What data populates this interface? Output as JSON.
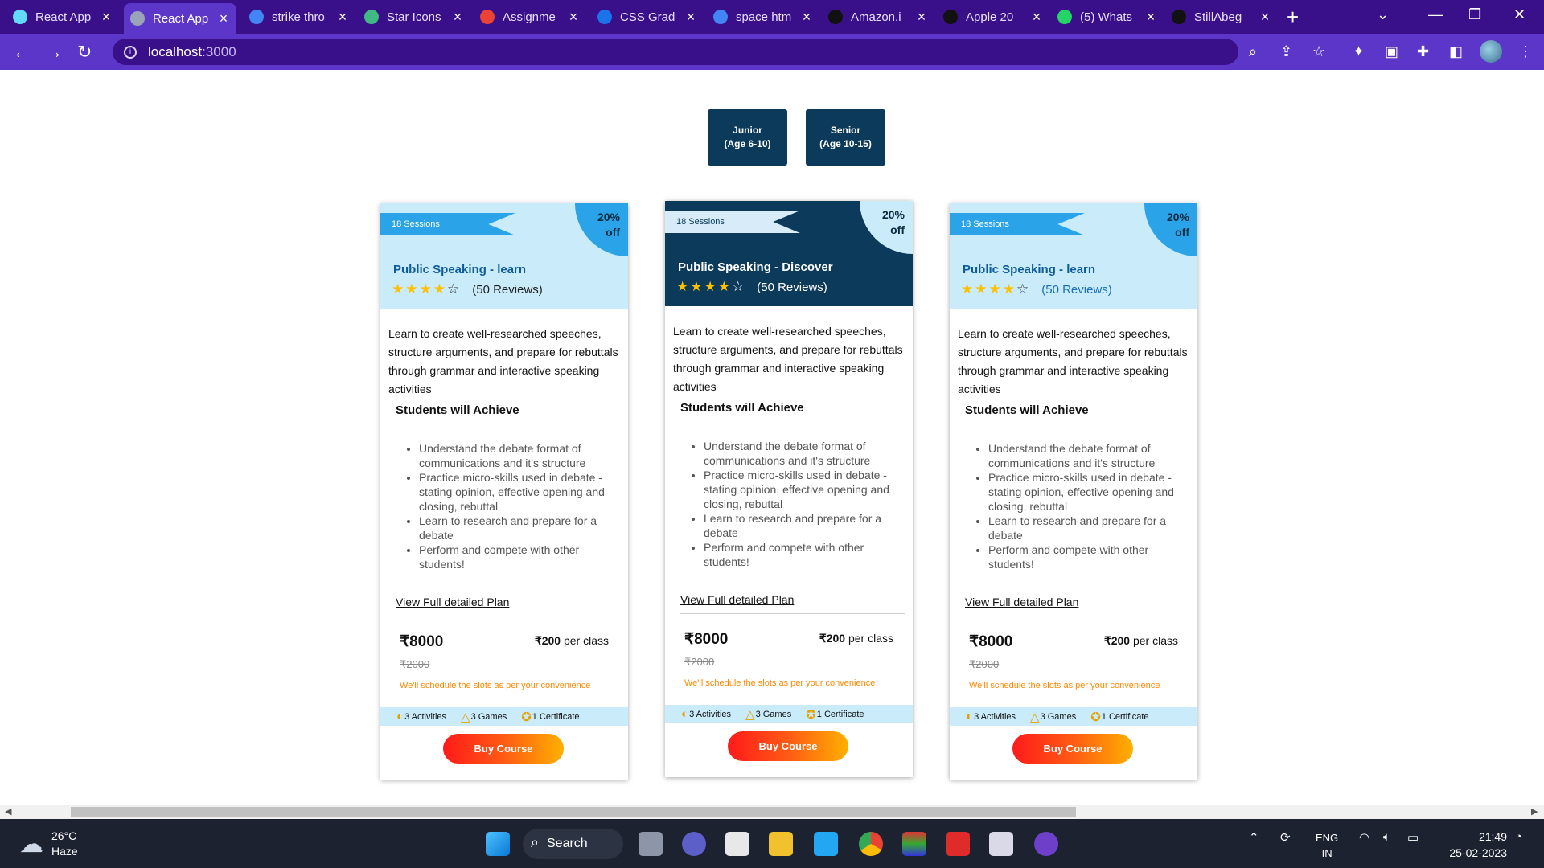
{
  "browser": {
    "tabs": [
      {
        "title": "React App",
        "favicon": "react-icon",
        "color": "#61dafb"
      },
      {
        "title": "React App",
        "favicon": "globe-icon",
        "color": "#9aa4b8"
      },
      {
        "title": "strike thro",
        "favicon": "google-icon",
        "color": "#4285f4"
      },
      {
        "title": "Star Icons",
        "favicon": "vue-icon",
        "color": "#42b883"
      },
      {
        "title": "Assignme",
        "favicon": "gmail-icon",
        "color": "#ea4335"
      },
      {
        "title": "CSS Grad",
        "favicon": "edge-icon",
        "color": "#1a73e8"
      },
      {
        "title": "space htm",
        "favicon": "google-icon",
        "color": "#4285f4"
      },
      {
        "title": "Amazon.i",
        "favicon": "amazon-icon",
        "color": "#111111"
      },
      {
        "title": "Apple 20",
        "favicon": "amazon-icon",
        "color": "#111111"
      },
      {
        "title": "(5) Whats",
        "favicon": "whatsapp-icon",
        "color": "#25d366"
      },
      {
        "title": "StillAbeg",
        "favicon": "github-icon",
        "color": "#111111"
      }
    ],
    "active_tab_index": 1,
    "url_host": "localhost",
    "url_port": ":3000"
  },
  "age_groups": [
    {
      "line1": "Junior",
      "line2": "(Age 6-10)"
    },
    {
      "line1": "Senior",
      "line2": "(Age 10-15)"
    }
  ],
  "cards": [
    {
      "sessions": "18 Sessions",
      "discount_pct": "20%",
      "discount_off": "off",
      "title": "Public Speaking - learn",
      "stars_filled": 4,
      "stars_total": 5,
      "reviews": "(50 Reviews)",
      "description": "Learn to create well-researched speeches, structure arguments, and prepare for rebuttals through grammar and interactive speaking activities",
      "achieve_title": "Students will Achieve",
      "bullets": [
        "Understand the debate format of communications and it's structure",
        "Practice micro-skills used in debate - stating opinion, effective opening and closing, rebuttal",
        "Learn to research and prepare for a debate",
        "Perform and compete with other students!"
      ],
      "plan_link": "View Full detailed Plan",
      "price": "₹8000",
      "per_class_amount": "₹200",
      "per_class_label": "per class",
      "old_price": "₹2000",
      "schedule_note": "We'll schedule the slots as per your convenience",
      "features": [
        "3 Activities",
        "3 Games",
        "1 Certificate"
      ],
      "buy_label": "Buy Course"
    },
    {
      "sessions": "18 Sessions",
      "discount_pct": "20%",
      "discount_off": "off",
      "title": "Public Speaking - Discover",
      "stars_filled": 4,
      "stars_total": 5,
      "reviews": "(50 Reviews)",
      "description": "Learn to create well-researched speeches, structure arguments, and prepare for rebuttals through grammar and interactive speaking activities",
      "achieve_title": "Students will Achieve",
      "bullets": [
        "Understand the debate format of communications and it's structure",
        "Practice micro-skills used in debate - stating opinion, effective opening and closing, rebuttal",
        "Learn to research and prepare for a debate",
        "Perform and compete with other students!"
      ],
      "plan_link": "View Full detailed Plan",
      "price": "₹8000",
      "per_class_amount": "₹200",
      "per_class_label": "per class",
      "old_price": "₹2000",
      "schedule_note": "We'll schedule the slots as per your convenience",
      "features": [
        "3 Activities",
        "3 Games",
        "1 Certificate"
      ],
      "buy_label": "Buy Course"
    },
    {
      "sessions": "18 Sessions",
      "discount_pct": "20%",
      "discount_off": "off",
      "title": "Public Speaking - learn",
      "stars_filled": 4,
      "stars_total": 5,
      "reviews": "(50 Reviews)",
      "description": "Learn to create well-researched speeches, structure arguments, and prepare for rebuttals through grammar and interactive speaking activities",
      "achieve_title": "Students will Achieve",
      "bullets": [
        "Understand the debate format of communications and it's structure",
        "Practice micro-skills used in debate - stating opinion, effective opening and closing, rebuttal",
        "Learn to research and prepare for a debate",
        "Perform and compete with other students!"
      ],
      "plan_link": "View Full detailed Plan",
      "price": "₹8000",
      "per_class_amount": "₹200",
      "per_class_label": "per class",
      "old_price": "₹2000",
      "schedule_note": "We'll schedule the slots as per your convenience",
      "features": [
        "3 Activities",
        "3 Games",
        "1 Certificate"
      ],
      "buy_label": "Buy Course"
    }
  ],
  "taskbar": {
    "temperature": "26°C",
    "weather": "Haze",
    "search_label": "Search",
    "language": "ENG",
    "region": "IN",
    "time": "21:49",
    "date": "25-02-2023"
  },
  "colors": {
    "tab_bar": "#3a0f8a",
    "address_bar": "#5c36c9",
    "card_header_light": "#c9ebfa",
    "card_header_dark": "#0b3a5a",
    "ribbon_blue": "#2aa3e8",
    "buy_gradient_start": "#ff1a1a",
    "buy_gradient_end": "#ffb000",
    "schedule_text": "#ff8800"
  }
}
